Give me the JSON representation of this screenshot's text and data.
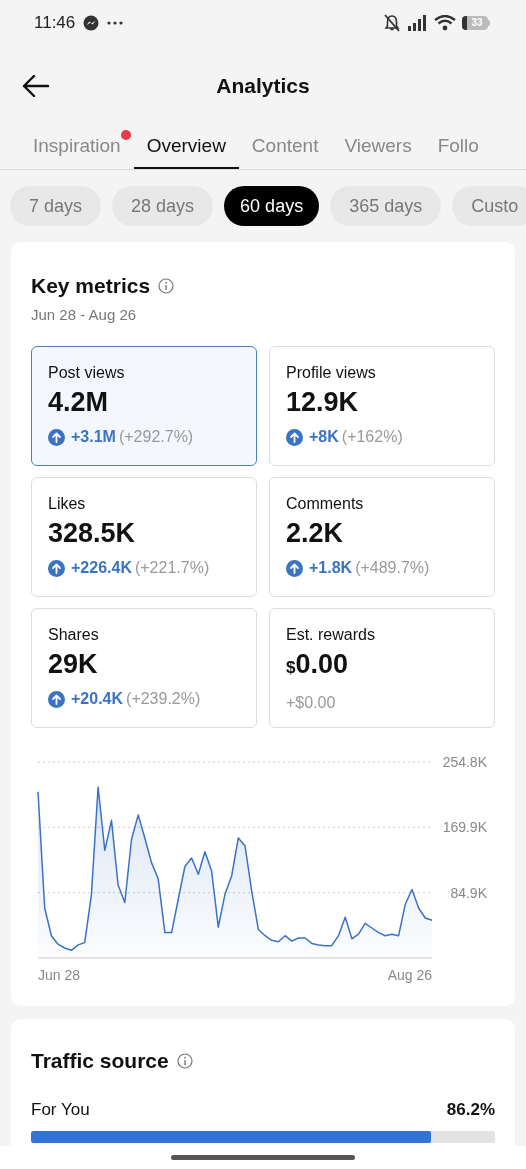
{
  "status_bar": {
    "time": "11:46",
    "battery": "33"
  },
  "header": {
    "title": "Analytics"
  },
  "tabs": [
    {
      "label": "Inspiration",
      "selected": false,
      "dot": true
    },
    {
      "label": "Overview",
      "selected": true,
      "dot": false
    },
    {
      "label": "Content",
      "selected": false,
      "dot": false
    },
    {
      "label": "Viewers",
      "selected": false,
      "dot": false
    },
    {
      "label": "Follo",
      "selected": false,
      "dot": false
    }
  ],
  "ranges": [
    {
      "label": "7 days",
      "selected": false
    },
    {
      "label": "28 days",
      "selected": false
    },
    {
      "label": "60 days",
      "selected": true
    },
    {
      "label": "365 days",
      "selected": false
    },
    {
      "label": "Custo",
      "selected": false
    }
  ],
  "key_metrics": {
    "title": "Key metrics",
    "date_range": "Jun 28 - Aug 26",
    "metrics": [
      {
        "label": "Post views",
        "value": "4.2M",
        "selected": true,
        "change": {
          "kind": "up",
          "amount": "+3.1M",
          "percent": "(+292.7%)"
        }
      },
      {
        "label": "Profile views",
        "value": "12.9K",
        "selected": false,
        "change": {
          "kind": "up",
          "amount": "+8K",
          "percent": "(+162%)"
        }
      },
      {
        "label": "Likes",
        "value": "328.5K",
        "selected": false,
        "change": {
          "kind": "up",
          "amount": "+226.4K",
          "percent": "(+221.7%)"
        }
      },
      {
        "label": "Comments",
        "value": "2.2K",
        "selected": false,
        "change": {
          "kind": "up",
          "amount": "+1.8K",
          "percent": "(+489.7%)"
        }
      },
      {
        "label": "Shares",
        "value": "29K",
        "selected": false,
        "change": {
          "kind": "up",
          "amount": "+20.4K",
          "percent": "(+239.2%)"
        }
      },
      {
        "label": "Est. rewards",
        "prefix": "$",
        "value": "0.00",
        "selected": false,
        "change": {
          "kind": "plain",
          "amount": "+$0.00"
        }
      }
    ],
    "chart_data": {
      "type": "area",
      "ylim": [
        0,
        254.8
      ],
      "yticks": [
        {
          "value": 84.9,
          "label": "84.9K"
        },
        {
          "value": 169.9,
          "label": "169.9K"
        },
        {
          "value": 254.8,
          "label": "254.8K"
        }
      ],
      "series": [
        {
          "color": "#3b73c4",
          "values": [
            216,
            65,
            29,
            18,
            13,
            10,
            17,
            20,
            82,
            222,
            140,
            179,
            95,
            72,
            154,
            186,
            156,
            124,
            103,
            33,
            33,
            76,
            119,
            130,
            109,
            138,
            113,
            40,
            83,
            107,
            156,
            146,
            87,
            37,
            29,
            23,
            21,
            29,
            22,
            26,
            26,
            19,
            17,
            16,
            16,
            29,
            53,
            25,
            31,
            45,
            39,
            33,
            29,
            31,
            29,
            70,
            89,
            65,
            52,
            49
          ]
        }
      ]
    },
    "axis_labels": [
      "Jun 28",
      "Aug 26"
    ]
  },
  "traffic_source": {
    "title": "Traffic source",
    "sources": [
      {
        "label": "For You",
        "value": "86.2%",
        "level": 0.862
      }
    ]
  }
}
